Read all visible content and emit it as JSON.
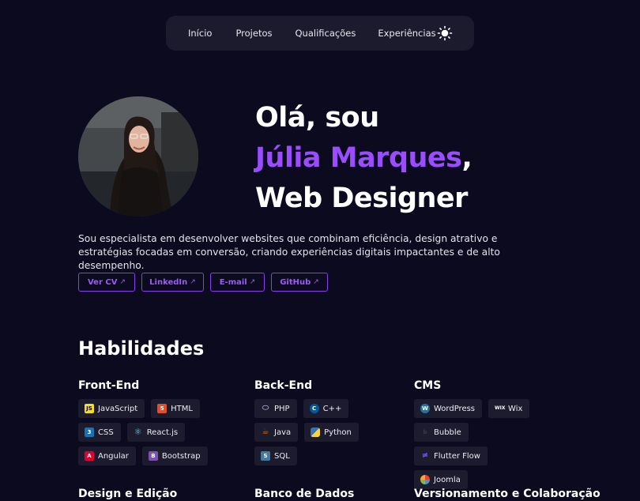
{
  "nav": {
    "items": [
      "Início",
      "Projetos",
      "Qualificações",
      "Experiências"
    ],
    "theme_icon": "sun-icon"
  },
  "hero": {
    "line1": "Olá, sou",
    "name": "Júlia Marques",
    "comma": ",",
    "line3": "Web Designer",
    "bio": "Sou especialista em desenvolver websites que combinam eficiência, design atrativo e estratégias focadas em conversão, criando experiências digitais impactantes e de alto desempenho.",
    "avatar_icon": "profile-photo"
  },
  "links": [
    {
      "label": "Ver CV",
      "icon": "external-link-icon"
    },
    {
      "label": "LinkedIn",
      "icon": "external-link-icon"
    },
    {
      "label": "E-mail",
      "icon": "external-link-icon"
    },
    {
      "label": "GitHub",
      "icon": "external-link-icon"
    }
  ],
  "skills": {
    "title": "Habilidades",
    "frontend": {
      "title": "Front-End",
      "items": [
        {
          "label": "JavaScript",
          "icon": "javascript-icon",
          "color": "#f7df1e"
        },
        {
          "label": "HTML",
          "icon": "html-icon",
          "color": "#e44d26"
        },
        {
          "label": "CSS",
          "icon": "css-icon",
          "color": "#1572b6"
        },
        {
          "label": "React.js",
          "icon": "react-icon",
          "color": "#61dafb"
        },
        {
          "label": "Angular",
          "icon": "angular-icon",
          "color": "#dd0031"
        },
        {
          "label": "Bootstrap",
          "icon": "bootstrap-icon",
          "color": "#7952b3"
        }
      ]
    },
    "backend": {
      "title": "Back-End",
      "items": [
        {
          "label": "PHP",
          "icon": "php-icon",
          "color": "#8892be"
        },
        {
          "label": "C++",
          "icon": "cpp-icon",
          "color": "#00599c"
        },
        {
          "label": "Java",
          "icon": "java-icon",
          "color": "#e76f00"
        },
        {
          "label": "Python",
          "icon": "python-icon",
          "color": "#3776ab"
        },
        {
          "label": "SQL",
          "icon": "sql-icon",
          "color": "#4479a1"
        }
      ]
    },
    "cms": {
      "title": "CMS",
      "items": [
        {
          "label": "WordPress",
          "icon": "wordpress-icon",
          "color": "#21759b"
        },
        {
          "label": "Wix",
          "icon": "wix-icon",
          "color": "#ffffff"
        },
        {
          "label": "Bubble",
          "icon": "bubble-icon",
          "color": "#2c2c3a"
        },
        {
          "label": "Flutter Flow",
          "icon": "flutterflow-icon",
          "color": "#4b39ef"
        },
        {
          "label": "Joomla",
          "icon": "joomla-icon",
          "color": "#f44321"
        }
      ]
    },
    "design": {
      "title": "Design e Edição"
    },
    "database": {
      "title": "Banco de Dados"
    },
    "versioning": {
      "title": "Versionamento e Colaboração"
    }
  },
  "colors": {
    "accent": "#9a4cff",
    "background": "#0c0a1f",
    "chip": "#1d1c2e"
  }
}
